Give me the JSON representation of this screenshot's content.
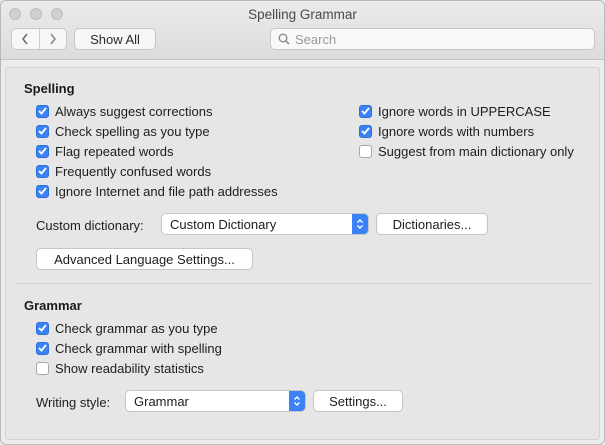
{
  "window": {
    "title": "Spelling  Grammar"
  },
  "toolbar": {
    "back_icon": "chevron-left-icon",
    "forward_icon": "chevron-right-icon",
    "show_all_label": "Show All",
    "search_placeholder": "Search",
    "search_value": ""
  },
  "spelling": {
    "title": "Spelling",
    "left_options": [
      {
        "label": "Always suggest corrections",
        "checked": true
      },
      {
        "label": "Check spelling as you type",
        "checked": true
      },
      {
        "label": "Flag repeated words",
        "checked": true
      },
      {
        "label": "Frequently confused words",
        "checked": true
      },
      {
        "label": "Ignore Internet and file path addresses",
        "checked": true
      }
    ],
    "right_options": [
      {
        "label": "Ignore words in UPPERCASE",
        "checked": true
      },
      {
        "label": "Ignore words with numbers",
        "checked": true
      },
      {
        "label": "Suggest from main dictionary only",
        "checked": false
      }
    ],
    "custom_dictionary_label": "Custom dictionary:",
    "custom_dictionary_value": "Custom Dictionary",
    "dictionaries_button": "Dictionaries...",
    "advanced_button": "Advanced Language Settings..."
  },
  "grammar": {
    "title": "Grammar",
    "options": [
      {
        "label": "Check grammar as you type",
        "checked": true
      },
      {
        "label": "Check grammar with spelling",
        "checked": true
      },
      {
        "label": "Show readability statistics",
        "checked": false
      }
    ],
    "writing_style_label": "Writing style:",
    "writing_style_value": "Grammar",
    "settings_button": "Settings..."
  },
  "colors": {
    "accent": "#3b82f6",
    "window_bg": "#ececec",
    "panel_bg": "#e6e6e6"
  }
}
